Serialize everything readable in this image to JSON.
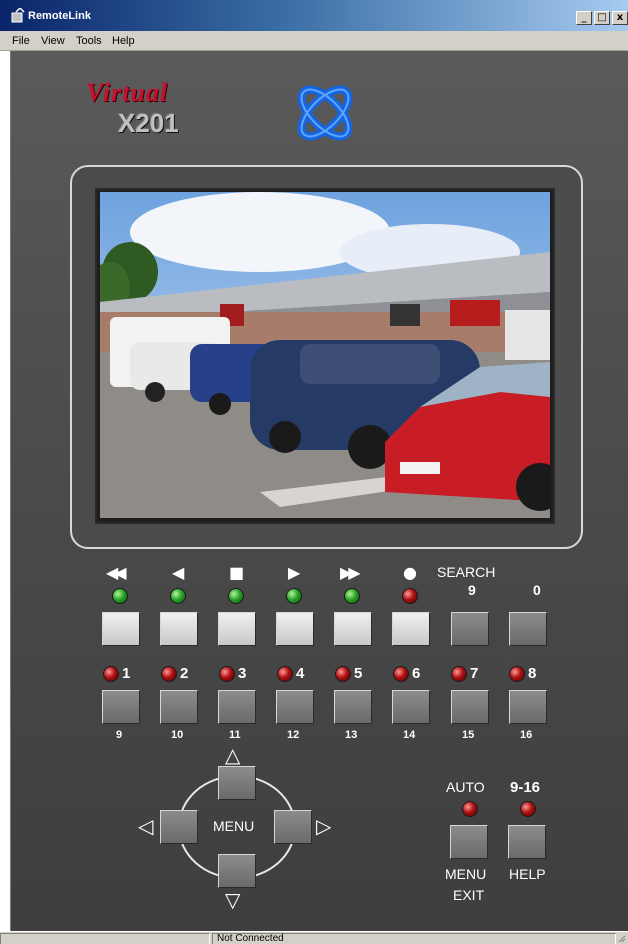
{
  "window": {
    "title": "RemoteLink",
    "minimize": "_",
    "restore": "□",
    "close": "x"
  },
  "menu": {
    "items": [
      "File",
      "View",
      "Tools",
      "Help"
    ]
  },
  "brand": {
    "script": "Virtual",
    "model": "X201"
  },
  "transport": {
    "icons": [
      "rewind-icon",
      "step-back-icon",
      "stop-icon",
      "play-icon",
      "fast-forward-icon",
      "record-icon"
    ],
    "glyphs": [
      "◀◀",
      "◀",
      "■",
      "▶",
      "▶▶",
      "●"
    ],
    "leds": [
      "green",
      "green",
      "green",
      "green",
      "green",
      "red"
    ],
    "search_label": "SEARCH",
    "search_keys": [
      "9",
      "0"
    ]
  },
  "cameras": {
    "top": [
      "1",
      "2",
      "3",
      "4",
      "5",
      "6",
      "7",
      "8"
    ],
    "bottom": [
      "9",
      "10",
      "11",
      "12",
      "13",
      "14",
      "15",
      "16"
    ]
  },
  "dpad": {
    "label": "MENU",
    "up": "△",
    "down": "▽",
    "left": "◁",
    "right": "▷"
  },
  "modes": {
    "auto_label": "AUTO",
    "nine_sixteen_label": "9-16",
    "menu_label": "MENU",
    "exit_label": "EXIT",
    "help_label": "HELP"
  },
  "status": {
    "text": "Not Connected"
  },
  "colors": {
    "led_green": "#2aa52a",
    "led_red": "#b01010",
    "device_body": "#4a4a4a"
  }
}
